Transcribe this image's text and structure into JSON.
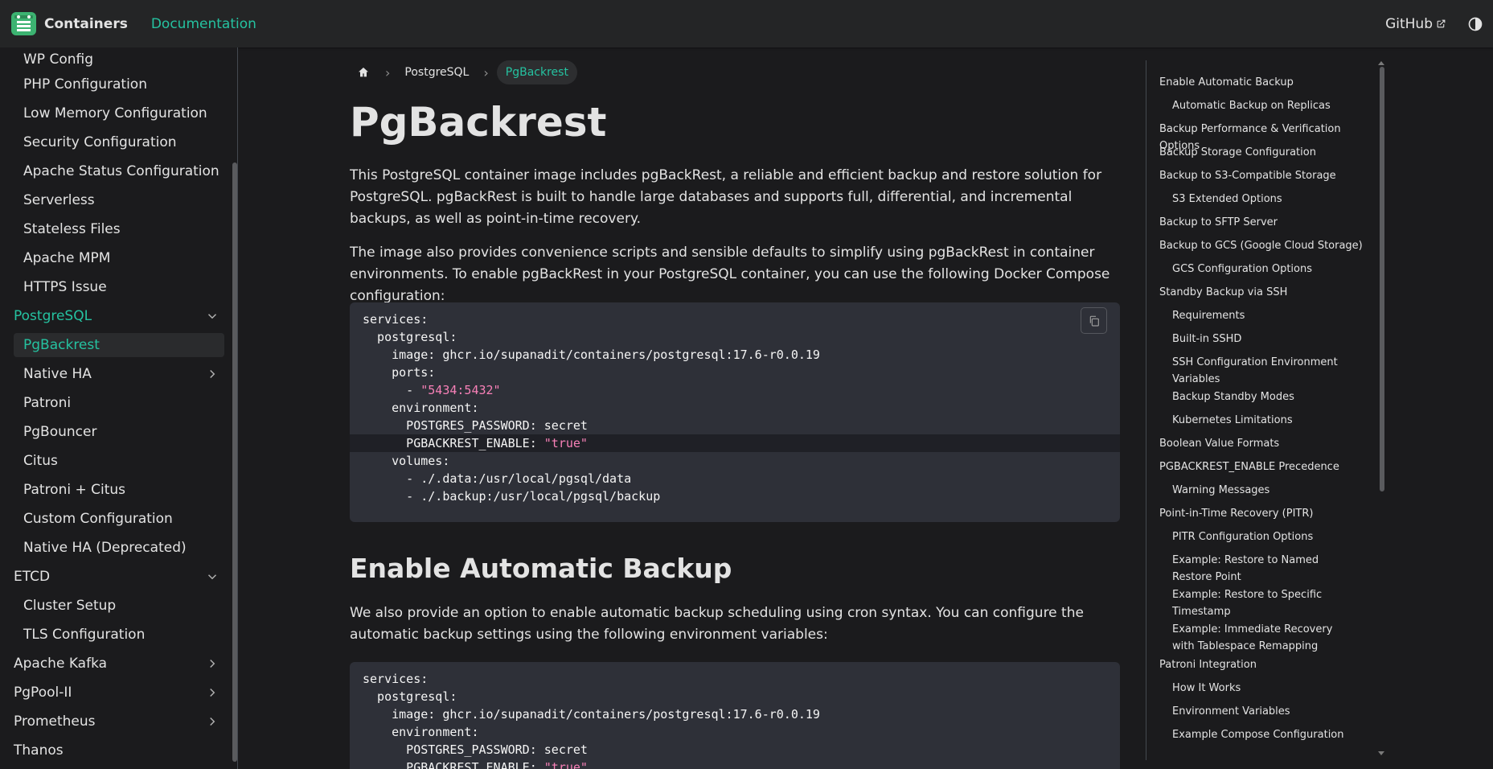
{
  "navbar": {
    "brand_title": "Containers",
    "documentation_label": "Documentation",
    "github_label": "GitHub"
  },
  "sidebar": {
    "items": [
      {
        "label": "WP Config",
        "level": 2
      },
      {
        "label": "PHP Configuration",
        "level": 2
      },
      {
        "label": "Low Memory Configuration",
        "level": 2
      },
      {
        "label": "Security Configuration",
        "level": 2
      },
      {
        "label": "Apache Status Configuration",
        "level": 2
      },
      {
        "label": "Serverless",
        "level": 2
      },
      {
        "label": "Stateless Files",
        "level": 2
      },
      {
        "label": "Apache MPM",
        "level": 2
      },
      {
        "label": "HTTPS Issue",
        "level": 2
      },
      {
        "label": "PostgreSQL",
        "level": 1,
        "state": "expanded-active"
      },
      {
        "label": "PgBackrest",
        "level": 2,
        "state": "current"
      },
      {
        "label": "Native HA",
        "level": 2,
        "state": "collapsed"
      },
      {
        "label": "Patroni",
        "level": 2
      },
      {
        "label": "PgBouncer",
        "level": 2
      },
      {
        "label": "Citus",
        "level": 2
      },
      {
        "label": "Patroni + Citus",
        "level": 2
      },
      {
        "label": "Custom Configuration",
        "level": 2
      },
      {
        "label": "Native HA (Deprecated)",
        "level": 2
      },
      {
        "label": "ETCD",
        "level": 1,
        "state": "expanded"
      },
      {
        "label": "Cluster Setup",
        "level": 2
      },
      {
        "label": "TLS Configuration",
        "level": 2
      },
      {
        "label": "Apache Kafka",
        "level": 1,
        "state": "collapsed"
      },
      {
        "label": "PgPool-II",
        "level": 1,
        "state": "collapsed"
      },
      {
        "label": "Prometheus",
        "level": 1,
        "state": "collapsed"
      },
      {
        "label": "Thanos",
        "level": 1
      }
    ]
  },
  "breadcrumb": {
    "home_icon": "home-icon",
    "items": [
      "PostgreSQL",
      "PgBackrest"
    ]
  },
  "main": {
    "title": "PgBackrest",
    "intro_p1": "This PostgreSQL container image includes pgBackRest, a reliable and efficient backup and restore solution for PostgreSQL. pgBackRest is built to handle large databases and supports full, differential, and incremental backups, as well as point-in-time recovery.",
    "intro_p2": "The image also provides convenience scripts and sensible defaults to simplify using pgBackRest in container environments. To enable pgBackRest in your PostgreSQL container, you can use the following Docker Compose configuration:",
    "code1": [
      {
        "text": "services:"
      },
      {
        "text": "  postgresql:"
      },
      {
        "text": "    image: ghcr.io/supanadit/containers/postgresql:17.6-r0.0.19"
      },
      {
        "text": "    ports:"
      },
      {
        "text": "      - ",
        "str": "\"5434:5432\""
      },
      {
        "text": "    environment:"
      },
      {
        "text": "      POSTGRES_PASSWORD: secret"
      },
      {
        "text": "      PGBACKREST_ENABLE: ",
        "str": "\"true\"",
        "highlight": true
      },
      {
        "text": "    volumes:"
      },
      {
        "text": "      - ./.data:/usr/local/pgsql/data"
      },
      {
        "text": "      - ./.backup:/usr/local/pgsql/backup"
      }
    ],
    "section_heading": "Enable Automatic Backup",
    "section_p1": "We also provide an option to enable automatic backup scheduling using cron syntax. You can configure the automatic backup settings using the following environment variables:",
    "code2": [
      {
        "text": "services:"
      },
      {
        "text": "  postgresql:"
      },
      {
        "text": "    image: ghcr.io/supanadit/containers/postgresql:17.6-r0.0.19"
      },
      {
        "text": "    environment:"
      },
      {
        "text": "      POSTGRES_PASSWORD: secret"
      },
      {
        "text": "      PGBACKREST_ENABLE: ",
        "str": "\"true\""
      }
    ]
  },
  "toc": {
    "items": [
      {
        "label": "Enable Automatic Backup",
        "level": 1
      },
      {
        "label": "Automatic Backup on Replicas",
        "level": 2
      },
      {
        "label": "Backup Performance & Verification Options",
        "level": 1
      },
      {
        "label": "Backup Storage Configuration",
        "level": 1
      },
      {
        "label": "Backup to S3-Compatible Storage",
        "level": 1
      },
      {
        "label": "S3 Extended Options",
        "level": 2
      },
      {
        "label": "Backup to SFTP Server",
        "level": 1
      },
      {
        "label": "Backup to GCS (Google Cloud Storage)",
        "level": 1
      },
      {
        "label": "GCS Configuration Options",
        "level": 2
      },
      {
        "label": "Standby Backup via SSH",
        "level": 1
      },
      {
        "label": "Requirements",
        "level": 2
      },
      {
        "label": "Built-in SSHD",
        "level": 2
      },
      {
        "label": "SSH Configuration Environment Variables",
        "level": 2
      },
      {
        "label": "Backup Standby Modes",
        "level": 2
      },
      {
        "label": "Kubernetes Limitations",
        "level": 2
      },
      {
        "label": "Boolean Value Formats",
        "level": 1
      },
      {
        "label": "PGBACKREST_ENABLE Precedence",
        "level": 1
      },
      {
        "label": "Warning Messages",
        "level": 2
      },
      {
        "label": "Point-in-Time Recovery (PITR)",
        "level": 1
      },
      {
        "label": "PITR Configuration Options",
        "level": 2
      },
      {
        "label": "Example: Restore to Named Restore Point",
        "level": 2
      },
      {
        "label": "Example: Restore to Specific Timestamp",
        "level": 2
      },
      {
        "label": "Example: Immediate Recovery with Tablespace Remapping",
        "level": 2
      },
      {
        "label": "Patroni Integration",
        "level": 1
      },
      {
        "label": "How It Works",
        "level": 2
      },
      {
        "label": "Environment Variables",
        "level": 2
      },
      {
        "label": "Example Compose Configuration",
        "level": 2
      }
    ]
  },
  "colors": {
    "accent": "#25c2a0",
    "background": "#1b1b1d",
    "navbar": "#242526",
    "code_bg": "#2e3038",
    "string": "#f780b7"
  }
}
